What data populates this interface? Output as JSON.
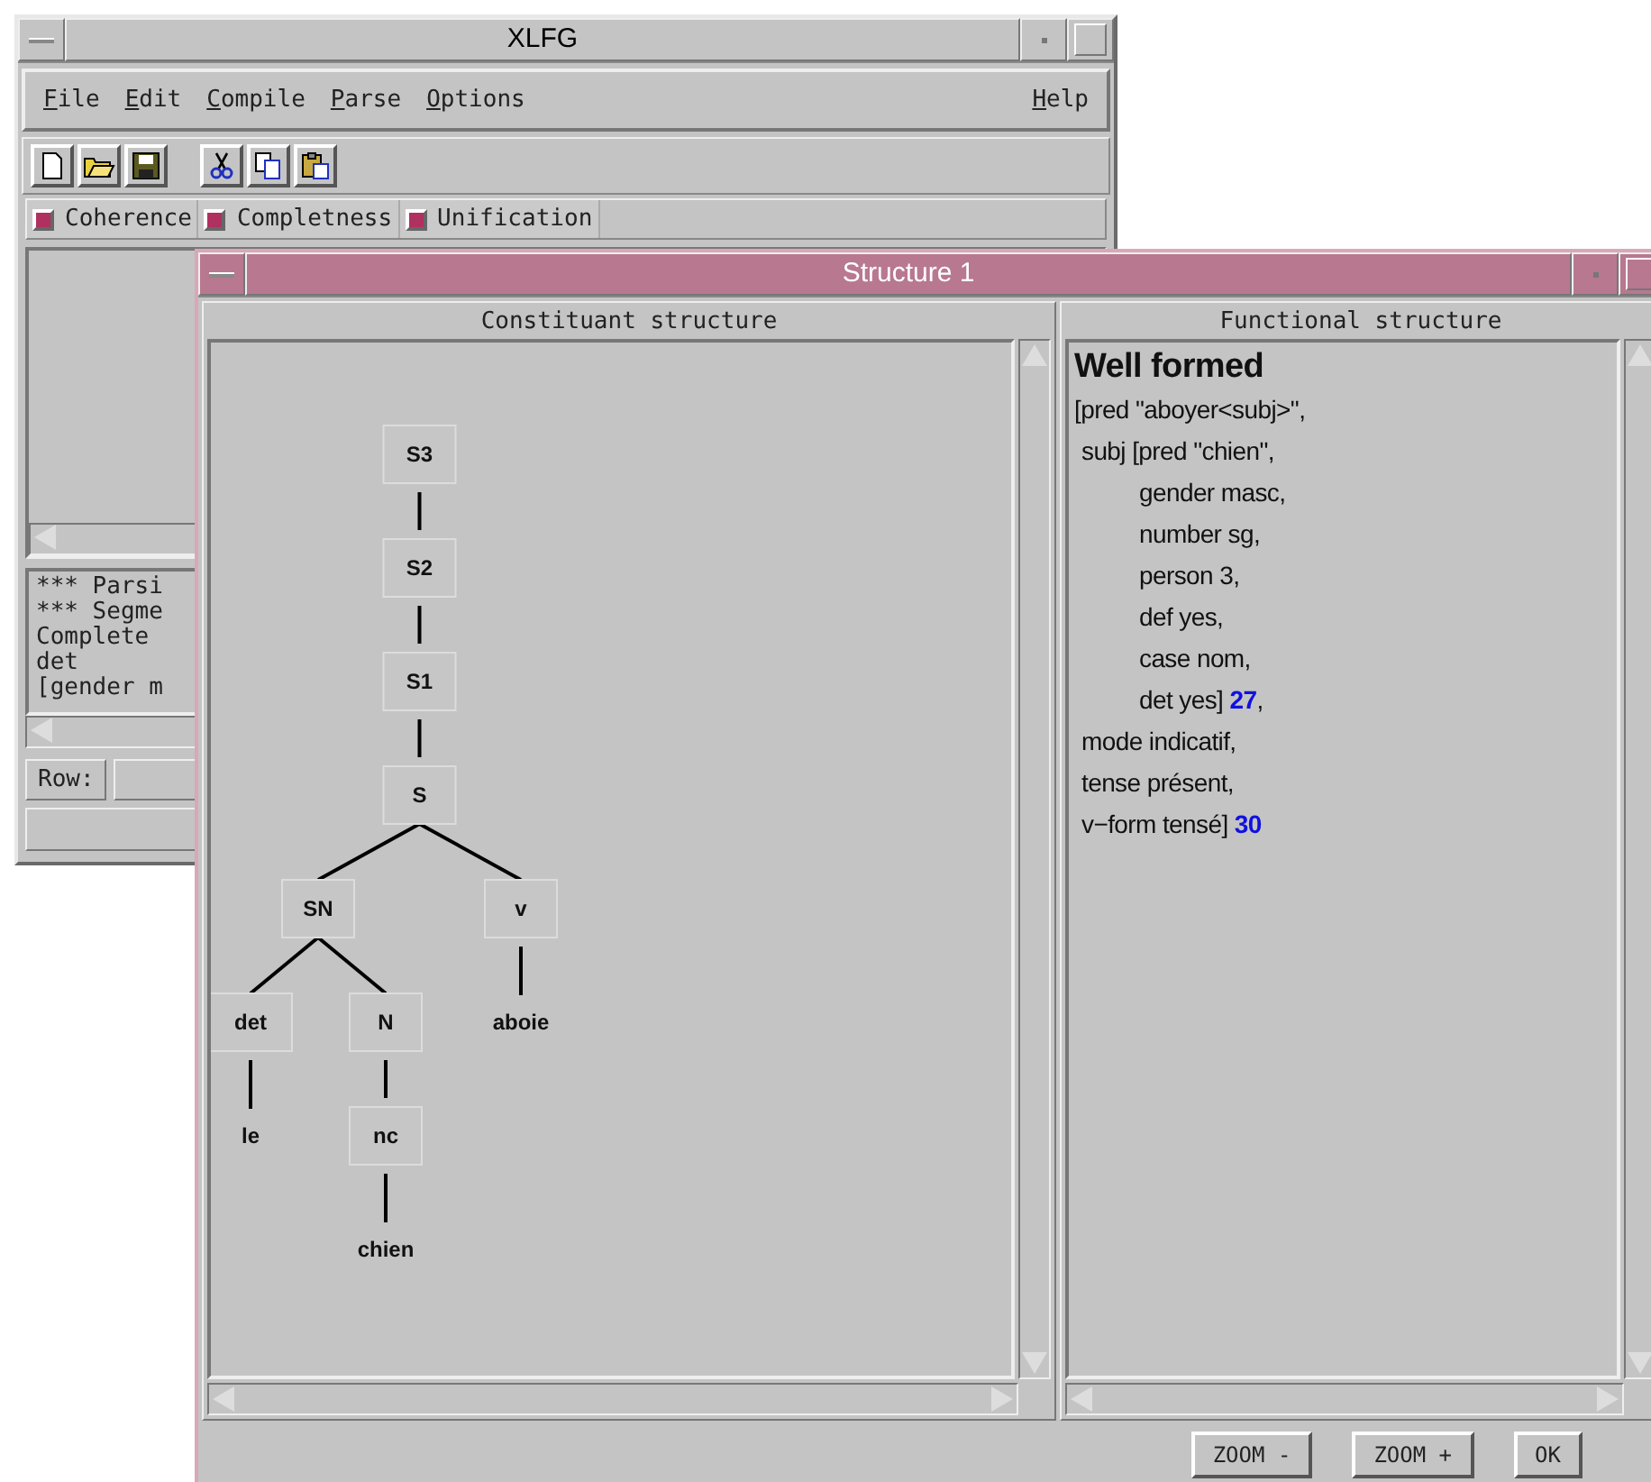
{
  "main_window": {
    "title": "XLFG",
    "menu": [
      "File",
      "Edit",
      "Compile",
      "Parse",
      "Options"
    ],
    "help_menu": "Help",
    "options": [
      {
        "label": "Coherence",
        "checked": true
      },
      {
        "label": "Completness",
        "checked": true
      },
      {
        "label": "Unification",
        "checked": true
      }
    ],
    "log_lines": [
      "*** Parsi",
      "*** Segme",
      "Complete",
      "det",
      "[gender m"
    ],
    "row_label": "Row:"
  },
  "structure_window": {
    "title": "Structure 1",
    "constituent_pane": {
      "title": "Constituant structure",
      "tree": {
        "label": "S3",
        "kind": "category",
        "children": [
          {
            "label": "S2",
            "kind": "category",
            "children": [
              {
                "label": "S1",
                "kind": "category",
                "children": [
                  {
                    "label": "S",
                    "kind": "category",
                    "children": [
                      {
                        "label": "SN",
                        "kind": "category",
                        "children": [
                          {
                            "label": "det",
                            "kind": "category",
                            "children": [
                              {
                                "label": "le",
                                "kind": "word"
                              }
                            ]
                          },
                          {
                            "label": "N",
                            "kind": "category",
                            "children": [
                              {
                                "label": "nc",
                                "kind": "category",
                                "children": [
                                  {
                                    "label": "chien",
                                    "kind": "word"
                                  }
                                ]
                              }
                            ]
                          }
                        ]
                      },
                      {
                        "label": "v",
                        "kind": "category",
                        "children": [
                          {
                            "label": "aboie",
                            "kind": "word"
                          }
                        ]
                      }
                    ]
                  }
                ]
              }
            ]
          }
        ]
      }
    },
    "functional_pane": {
      "title": "Functional structure",
      "status": "Well formed",
      "lines": [
        {
          "text": "[pred \"aboyer<subj>\","
        },
        {
          "text": "subj [pred \"chien\",",
          "children": [
            {
              "text": "gender masc,"
            },
            {
              "text": "number sg,"
            },
            {
              "text": "person 3,"
            },
            {
              "text": "def yes,"
            },
            {
              "text": "case nom,"
            },
            {
              "text": "det yes] **27**,"
            }
          ]
        },
        {
          "text": "mode indicatif,"
        },
        {
          "text": "tense présent,"
        },
        {
          "text": "v−form tensé] **30**"
        }
      ]
    },
    "buttons": [
      "ZOOM -",
      "ZOOM +",
      "OK"
    ]
  }
}
